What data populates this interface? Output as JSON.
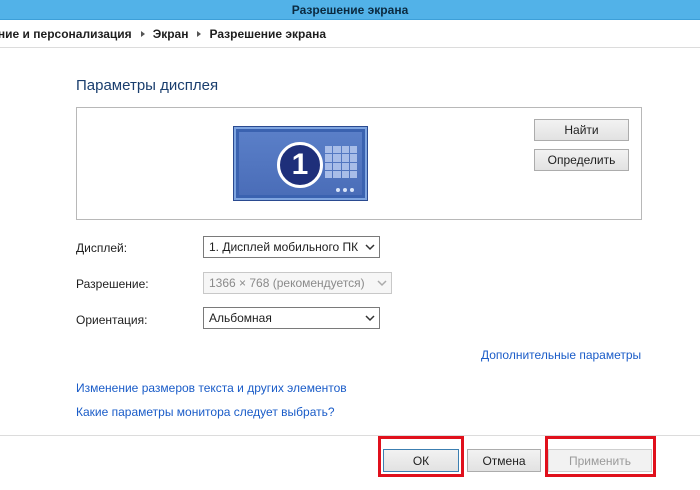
{
  "window": {
    "title": "Разрешение экрана"
  },
  "breadcrumb": [
    "нение и персонализация",
    "Экран",
    "Разрешение экрана"
  ],
  "section_title": "Параметры дисплея",
  "preview": {
    "monitor_number": "1",
    "find_label": "Найти",
    "identify_label": "Определить"
  },
  "fields": {
    "display": {
      "label": "Дисплей:",
      "value": "1. Дисплей мобильного ПК"
    },
    "resolution": {
      "label": "Разрешение:",
      "value": "1366 × 768 (рекомендуется)"
    },
    "orientation": {
      "label": "Ориентация:",
      "value": "Альбомная"
    }
  },
  "links": {
    "advanced": "Дополнительные параметры",
    "text_size": "Изменение размеров текста и других элементов",
    "which_settings": "Какие параметры монитора следует выбрать?"
  },
  "buttons": {
    "ok": "ОК",
    "cancel": "Отмена",
    "apply": "Применить"
  },
  "colors": {
    "titlebar": "#52b2e8",
    "link": "#1a5cc8",
    "highlight": "#e0101c",
    "monitor": "#3a62b0"
  }
}
